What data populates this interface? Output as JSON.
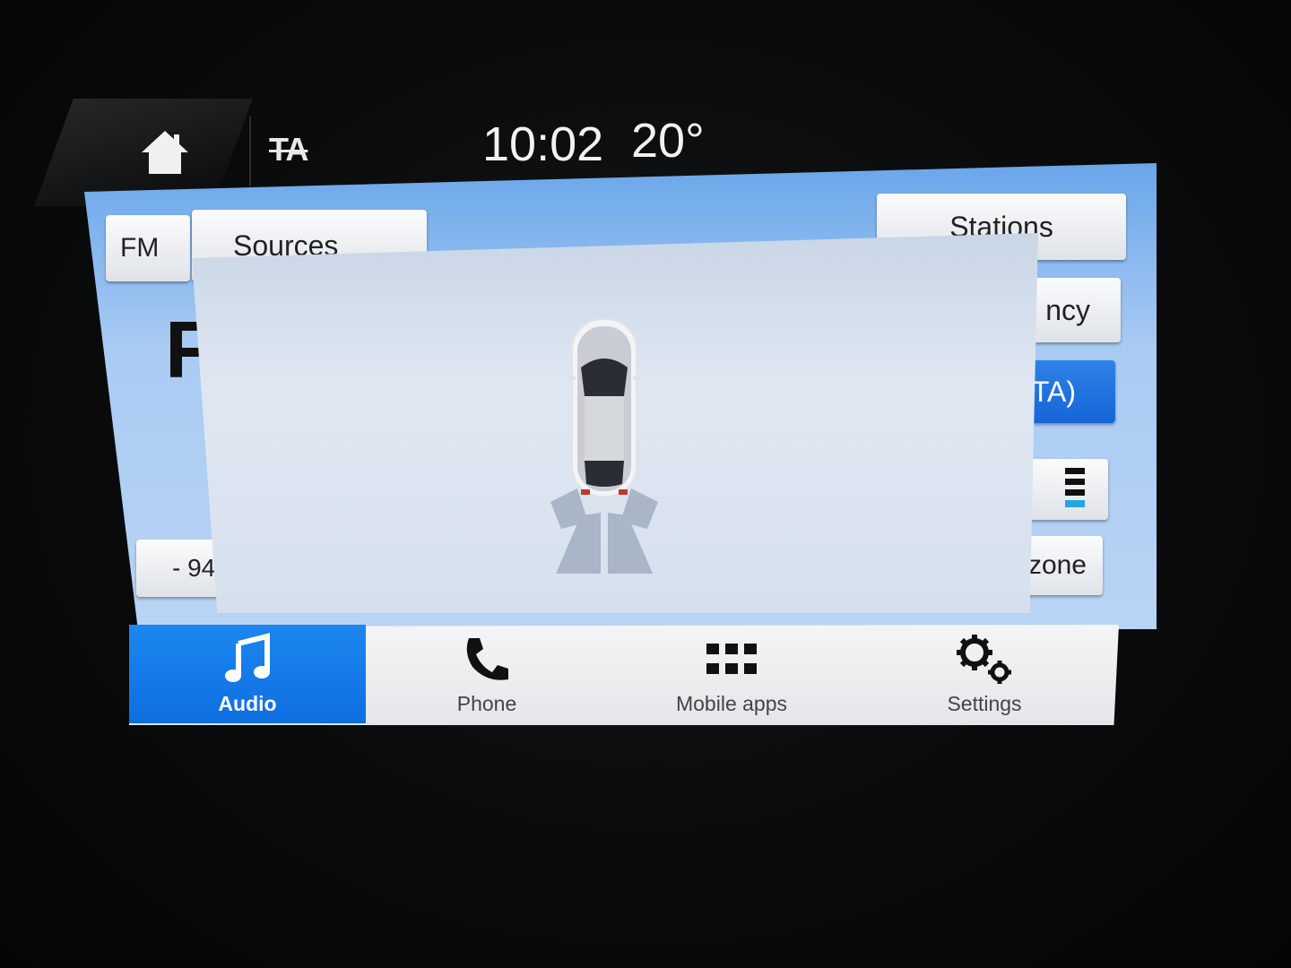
{
  "status_bar": {
    "ta": "TA",
    "time": "10:02",
    "temperature": "20°"
  },
  "radio": {
    "band": "FM",
    "sources_label": "Sources",
    "stations_label": "Stations",
    "frequency_partial": "ncy",
    "ta_partial": "TA)",
    "preset_partial": "- 94",
    "zone_partial": "kzone",
    "station_letter": "F"
  },
  "nav": {
    "audio": "Audio",
    "phone": "Phone",
    "mobile_apps": "Mobile apps",
    "settings": "Settings"
  },
  "colors": {
    "accent": "#1576e6",
    "screen_blue": "#8fbaf0"
  }
}
